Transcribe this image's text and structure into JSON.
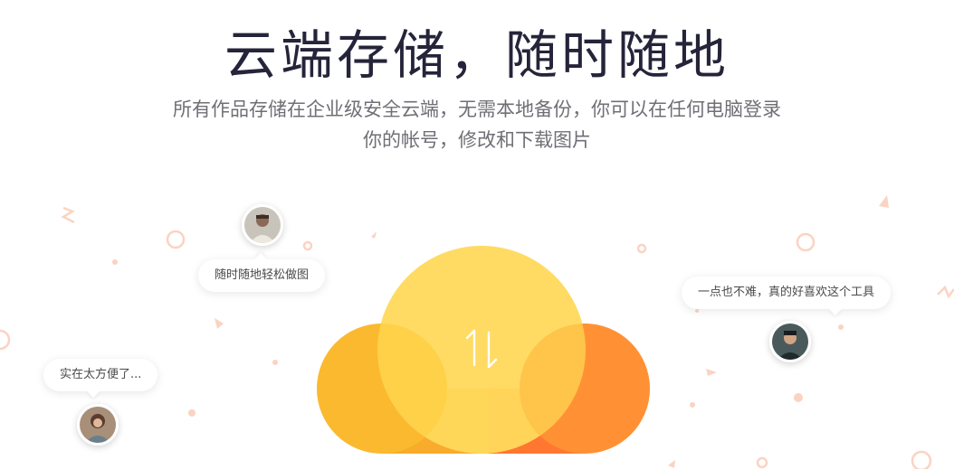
{
  "hero": {
    "title": "云端存储，随时随地",
    "subtitle_line1": "所有作品存储在企业级安全云端，无需本地备份，你可以在任何电脑登录",
    "subtitle_line2": "你的帐号，修改和下载图片"
  },
  "testimonials": [
    {
      "text": "随时随地轻松做图"
    },
    {
      "text": "实在太方便了..."
    },
    {
      "text": "一点也不难，真的好喜欢这个工具"
    }
  ],
  "icons": {
    "cloud": "cloud-icon",
    "transfer": "upload-download-arrows-icon"
  },
  "colors": {
    "title": "#25243a",
    "subtitle": "#6f6f76",
    "cloud_left": "#f9ab2c",
    "cloud_center": "#ffd95b",
    "cloud_right": "#ff7731",
    "decoration": "#fbd3c2"
  }
}
